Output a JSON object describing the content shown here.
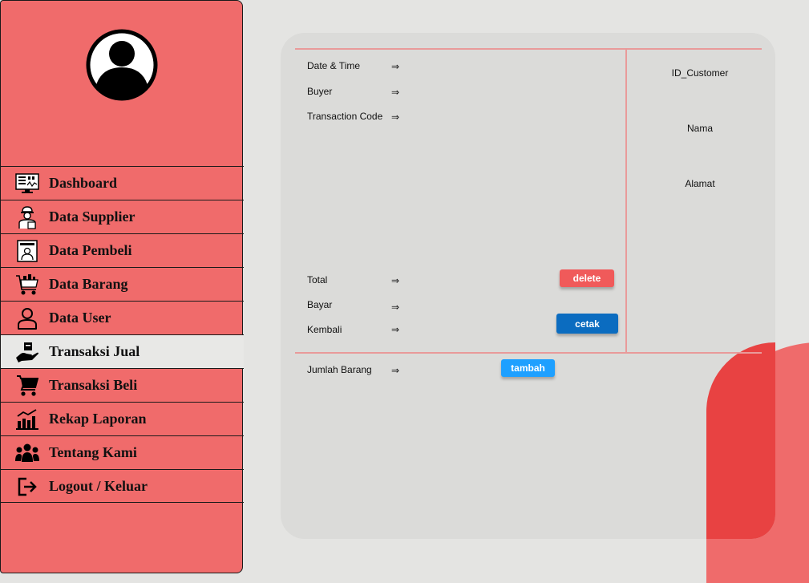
{
  "sidebar": {
    "items": [
      {
        "label": "Dashboard",
        "icon": "dashboard-monitor-icon"
      },
      {
        "label": "Data Supplier",
        "icon": "supplier-worker-icon"
      },
      {
        "label": "Data Pembeli",
        "icon": "buyer-profile-icon"
      },
      {
        "label": "Data Barang",
        "icon": "shopping-cart-goods-icon"
      },
      {
        "label": "Data User",
        "icon": "user-outline-icon"
      },
      {
        "label": "Transaksi Jual",
        "icon": "hand-box-icon"
      },
      {
        "label": "Transaksi Beli",
        "icon": "cart-icon"
      },
      {
        "label": "Rekap Laporan",
        "icon": "report-chart-icon"
      },
      {
        "label": "Tentang Kami",
        "icon": "team-icon"
      },
      {
        "label": "Logout / Keluar",
        "icon": "logout-icon"
      }
    ],
    "active": "Transaksi Jual"
  },
  "form": {
    "date_time": "Date & Time",
    "buyer": "Buyer",
    "transaction_code": "Transaction Code",
    "total": "Total",
    "bayar": "Bayar",
    "kembali": "Kembali",
    "jumlah_barang": "Jumlah Barang",
    "arrow": "⇒"
  },
  "customer": {
    "id": "ID_Customer",
    "nama": "Nama",
    "alamat": "Alamat"
  },
  "buttons": {
    "delete": "delete",
    "cetak": "cetak",
    "tambah": "tambah"
  },
  "colors": {
    "sidebar": "#f06b6b",
    "active_item": "#e8e8e6",
    "delete": "#f05a5a",
    "cetak": "#0b6cc0",
    "tambah": "#1ea0ff",
    "divider": "#e99a9a"
  }
}
